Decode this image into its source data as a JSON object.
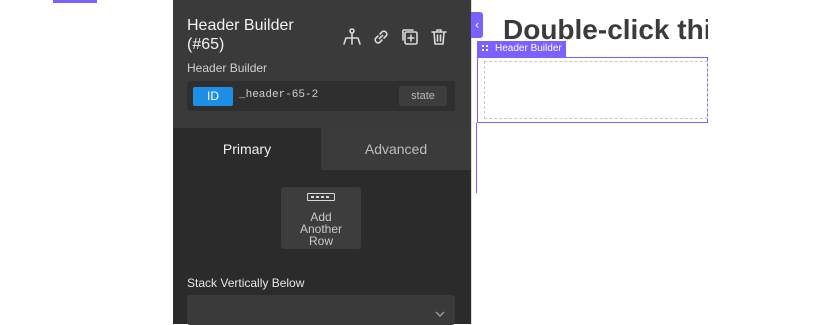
{
  "panel": {
    "title_line1": "Header Builder",
    "title_line2": "(#65)",
    "subtitle": "Header Builder",
    "icons": [
      "structure-icon",
      "link-icon",
      "duplicate-icon",
      "trash-icon"
    ],
    "id_badge": "ID",
    "id_value": "_header-65-2",
    "state_label": "state",
    "tabs": [
      {
        "label": "Primary",
        "active": true
      },
      {
        "label": "Advanced",
        "active": false
      }
    ],
    "add_row": {
      "line1": "Add",
      "line2": "Another",
      "line3": "Row"
    },
    "stack_label": "Stack Vertically Below",
    "stack_value": ""
  },
  "canvas": {
    "heading": "Double-click thi",
    "element_label": "Header Builder"
  },
  "colors": {
    "accent": "#7b61ff",
    "id_badge": "#1e8fe6",
    "panel_bg": "#2b2b2b"
  }
}
